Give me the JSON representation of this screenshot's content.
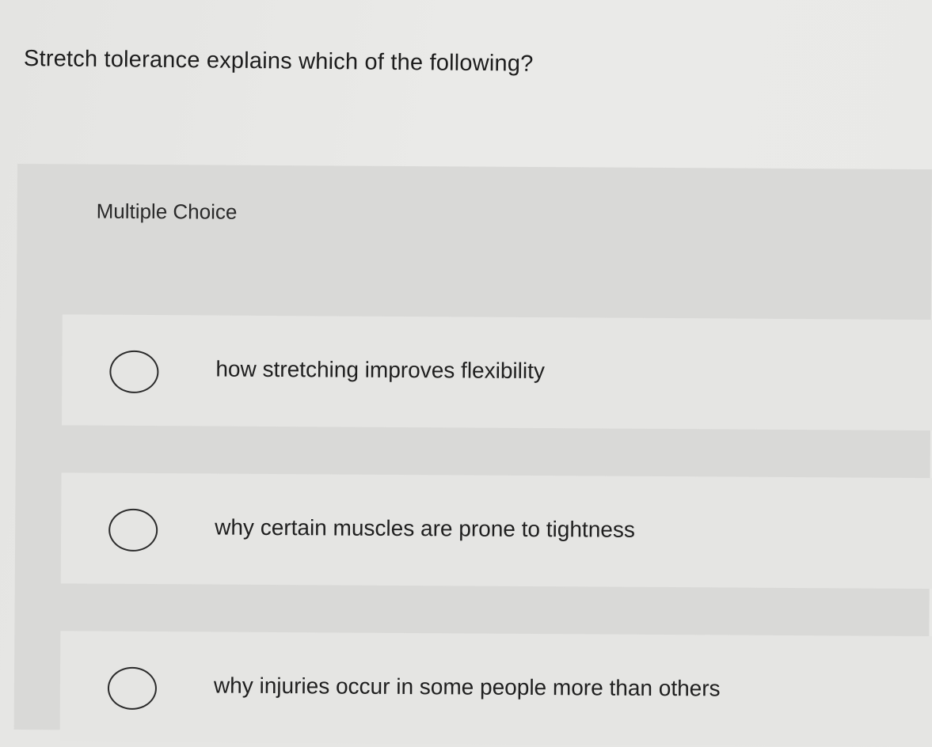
{
  "question": {
    "text": "Stretch tolerance explains which of the following?"
  },
  "multiple_choice": {
    "header": "Multiple Choice",
    "options": [
      {
        "label": "how stretching improves flexibility",
        "selected": false
      },
      {
        "label": "why certain muscles are prone to tightness",
        "selected": false
      },
      {
        "label": "why injuries occur in some people more than others",
        "selected": false
      }
    ]
  }
}
